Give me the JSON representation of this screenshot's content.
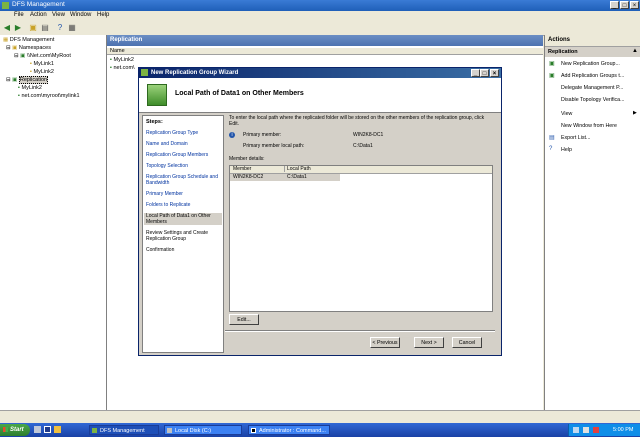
{
  "window": {
    "title": "DFS Management"
  },
  "menu": [
    "File",
    "Action",
    "View",
    "Window",
    "Help"
  ],
  "tree": {
    "root": "DFS Management",
    "namespaces": "Namespaces",
    "namespace_root": "\\\\Net.com\\MyRoot",
    "links": [
      "MyLink1",
      "MyLink2"
    ],
    "replication": "Replication",
    "replication_items": [
      "MyLink2",
      "net.com\\myroot\\mylink1"
    ]
  },
  "center": {
    "header": "Replication",
    "column_name": "Name",
    "rows": [
      "MyLink2",
      "net.com\\"
    ]
  },
  "actions": {
    "header": "Actions",
    "section": "Replication",
    "items": [
      "New Replication Group...",
      "Add Replication Groups t...",
      "Delegate Management P...",
      "Disable Topology Verifica...",
      "View",
      "New Window from Here",
      "Export List...",
      "Help"
    ]
  },
  "wizard": {
    "title": "New Replication Group Wizard",
    "heading": "Local Path of Data1 on Other Members",
    "steps_label": "Steps:",
    "steps": [
      "Replication Group Type",
      "Name and Domain",
      "Replication Group Members",
      "Topology Selection",
      "Replication Group Schedule and Bandwidth",
      "Primary Member",
      "Folders to Replicate",
      "Local Path of Data1 on Other Members",
      "Review Settings and Create Replication Group",
      "Confirmation"
    ],
    "intro": "To enter the local path where the replicated folder will be stored on the other members of the replication group, click Edit.",
    "primary_member_label": "Primary member:",
    "primary_member_value": "WIN2K8-DC1",
    "primary_path_label": "Primary member local path:",
    "primary_path_value": "C:\\Data1",
    "member_details_label": "Member details:",
    "col_member": "Member",
    "col_local_path": "Local Path",
    "row_member": "WIN2K8-DC2",
    "row_path": "C:\\Data1",
    "edit": "Edit...",
    "previous": "< Previous",
    "next": "Next >",
    "cancel": "Cancel"
  },
  "taskbar": {
    "start": "Start",
    "tasks": [
      "DFS Management",
      "Local Disk (C:)",
      "Administrator : Command..."
    ],
    "clock": "5:00 PM"
  }
}
